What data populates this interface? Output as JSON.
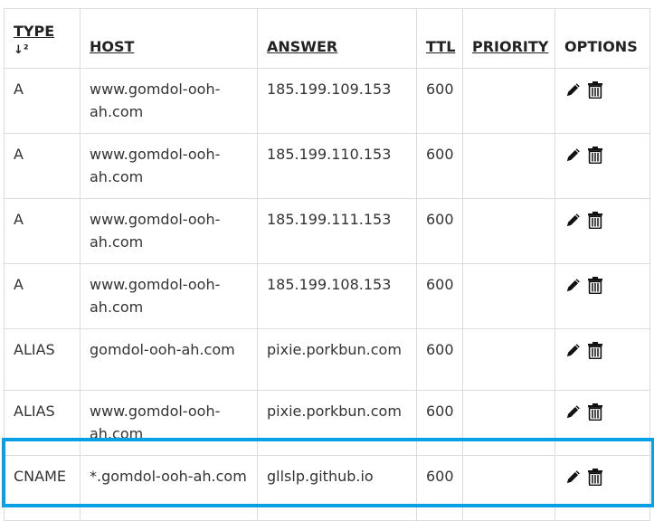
{
  "table": {
    "headers": {
      "type": "TYPE",
      "type_sort_glyph": "↓²",
      "host": "HOST",
      "answer": "ANSWER",
      "ttl": "TTL",
      "priority": "PRIORITY",
      "options": "OPTIONS"
    },
    "icons": {
      "sort": "sort-ascending-icon",
      "edit": "pencil-icon",
      "delete": "trash-icon"
    },
    "rows": [
      {
        "type": "A",
        "host": "www.gomdol-ooh-ah.com",
        "answer": "185.199.109.153",
        "ttl": "600",
        "priority": ""
      },
      {
        "type": "A",
        "host": "www.gomdol-ooh-ah.com",
        "answer": "185.199.110.153",
        "ttl": "600",
        "priority": ""
      },
      {
        "type": "A",
        "host": "www.gomdol-ooh-ah.com",
        "answer": "185.199.111.153",
        "ttl": "600",
        "priority": ""
      },
      {
        "type": "A",
        "host": "www.gomdol-ooh-ah.com",
        "answer": "185.199.108.153",
        "ttl": "600",
        "priority": ""
      },
      {
        "type": "ALIAS",
        "host": "gomdol-ooh-ah.com",
        "answer": "pixie.porkbun.com",
        "ttl": "600",
        "priority": ""
      },
      {
        "type": "ALIAS",
        "host": "www.gomdol-ooh-ah.com",
        "answer": "pixie.porkbun.com",
        "ttl": "600",
        "priority": ""
      },
      {
        "type": "CNAME",
        "host": "*.gomdol-ooh-ah.com",
        "answer": "gllslp.github.io",
        "ttl": "600",
        "priority": ""
      }
    ]
  },
  "highlight_color": "#0aa0e6"
}
